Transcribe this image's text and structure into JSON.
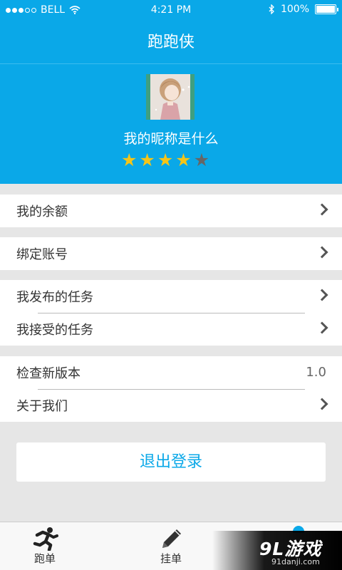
{
  "status_bar": {
    "carrier": "BELL",
    "time": "4:21 PM",
    "battery": "100%",
    "battery_level": 1.0
  },
  "header": {
    "title": "跑跑侠"
  },
  "profile": {
    "nickname": "我的昵称是什么",
    "rating": 4,
    "rating_max": 5,
    "star_color_on": "#f5c518",
    "star_color_off": "#666666"
  },
  "menu": {
    "balance": "我的余额",
    "bind_account": "绑定账号",
    "published_tasks": "我发布的任务",
    "accepted_tasks": "我接受的任务",
    "check_update": "检查新版本",
    "version": "1.0",
    "about_us": "关于我们"
  },
  "logout_button": "退出登录",
  "tabbar": {
    "tabs": [
      {
        "label": "跑单",
        "icon": "runner-icon"
      },
      {
        "label": "挂单",
        "icon": "pencil-icon"
      }
    ]
  },
  "watermark": {
    "logo": "9L游戏",
    "url": "91danji.com"
  },
  "colors": {
    "accent": "#0aa8e8",
    "background": "#e6e6e6"
  }
}
